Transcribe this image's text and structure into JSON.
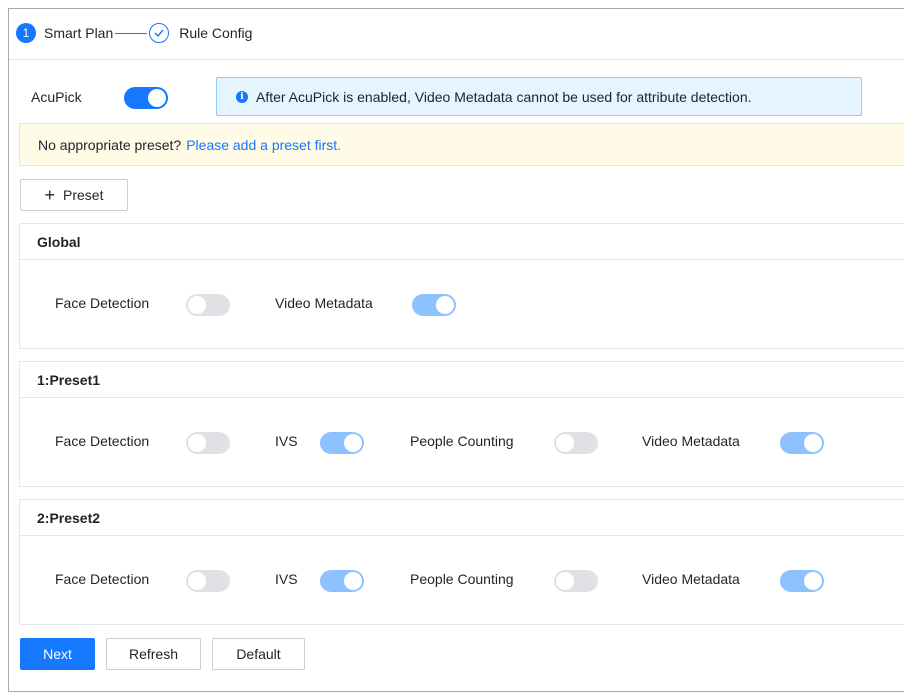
{
  "stepper": {
    "step1_number": "1",
    "step1_label": "Smart Plan",
    "step2_label": "Rule Config"
  },
  "acupick": {
    "label": "AcuPick",
    "enabled": true
  },
  "info": {
    "icon": "info-icon",
    "text": "After AcuPick is enabled, Video Metadata cannot be used for attribute detection."
  },
  "warning": {
    "text": "No appropriate preset?",
    "link": "Please add a preset first."
  },
  "preset_button": {
    "icon": "+",
    "label": "Preset"
  },
  "sections": [
    {
      "title": "Global",
      "items": [
        {
          "label": "Face Detection",
          "on": false
        },
        {
          "label": "Video Metadata",
          "on": true
        }
      ]
    },
    {
      "title": "1:Preset1",
      "items": [
        {
          "label": "Face Detection",
          "on": false
        },
        {
          "label": "IVS",
          "on": true
        },
        {
          "label": "People Counting",
          "on": false
        },
        {
          "label": "Video Metadata",
          "on": true
        }
      ]
    },
    {
      "title": "2:Preset2",
      "items": [
        {
          "label": "Face Detection",
          "on": false
        },
        {
          "label": "IVS",
          "on": true
        },
        {
          "label": "People Counting",
          "on": false
        },
        {
          "label": "Video Metadata",
          "on": true
        }
      ]
    }
  ],
  "footer": {
    "next": "Next",
    "refresh": "Refresh",
    "default": "Default"
  },
  "colors": {
    "primary": "#1677ff",
    "toggle_on_disabled": "#8ec2ff",
    "toggle_off": "#dfe1e5",
    "info_bg": "#e6f4ff",
    "warning_bg": "#fffbe6"
  }
}
